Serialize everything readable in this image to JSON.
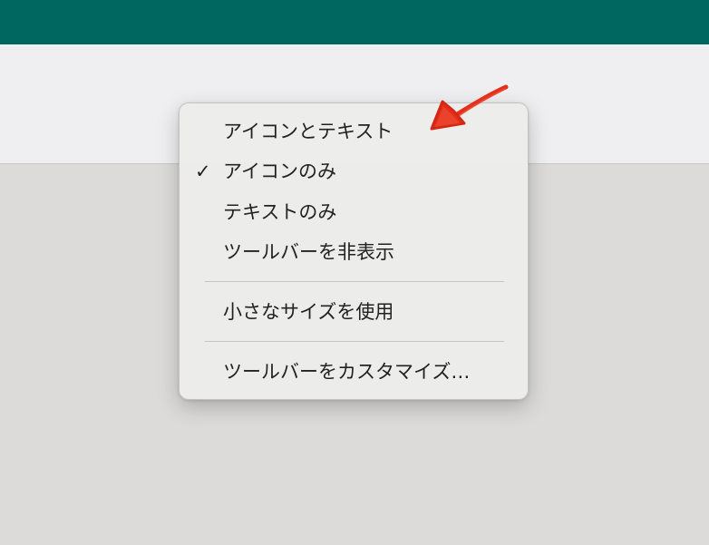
{
  "menu": {
    "items": [
      {
        "label": "アイコンとテキスト",
        "checked": false
      },
      {
        "label": "アイコンのみ",
        "checked": true,
        "check_glyph": "✓"
      },
      {
        "label": "テキストのみ",
        "checked": false
      },
      {
        "label": "ツールバーを非表示",
        "checked": false
      },
      {
        "label": "小さなサイズを使用",
        "checked": false
      },
      {
        "label": "ツールバーをカスタマイズ…",
        "checked": false
      }
    ]
  },
  "annotation": {
    "icon": "red-arrow-icon",
    "color": "#e2301c"
  },
  "colors": {
    "title_bar": "#006660",
    "toolbar_bg": "#efeff1",
    "content_bg": "#dcdbda",
    "menu_bg": "#ecebea"
  }
}
